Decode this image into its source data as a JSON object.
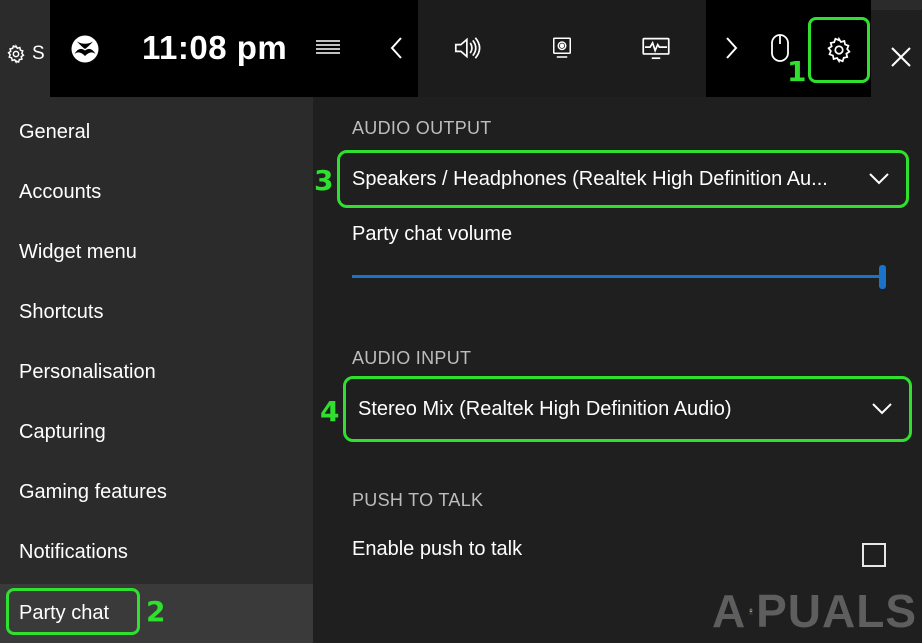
{
  "window": {
    "title_partial": "S"
  },
  "gamebar": {
    "clock": "11:08 pm"
  },
  "sidebar": {
    "items": [
      {
        "label": "General"
      },
      {
        "label": "Accounts"
      },
      {
        "label": "Widget menu"
      },
      {
        "label": "Shortcuts"
      },
      {
        "label": "Personalisation"
      },
      {
        "label": "Capturing"
      },
      {
        "label": "Gaming features"
      },
      {
        "label": "Notifications"
      },
      {
        "label": "Party chat"
      }
    ],
    "selected_index": 8
  },
  "main": {
    "audio_output": {
      "label": "AUDIO OUTPUT",
      "selected": "Speakers / Headphones (Realtek High Definition Au..."
    },
    "party_chat_volume": {
      "label": "Party chat volume",
      "value_fraction": 1.0
    },
    "audio_input": {
      "label": "AUDIO INPUT",
      "selected": "Stereo Mix (Realtek High Definition Audio)"
    },
    "push_to_talk": {
      "label": "PUSH TO TALK",
      "option_label": "Enable push to talk",
      "checked": false
    }
  },
  "markers": {
    "m1": "1",
    "m2": "2",
    "m3": "3",
    "m4": "4"
  },
  "watermark": {
    "text": "PUALS",
    "prefix": "A"
  },
  "icons": {
    "xbox": "xbox-logo-icon",
    "menu": "menu-icon",
    "prev": "chevron-left-icon",
    "next": "chevron-right-icon",
    "audio": "speaker-icon",
    "capture": "capture-icon",
    "performance": "performance-icon",
    "mouse": "mouse-icon",
    "settings": "gear-icon",
    "close": "close-icon"
  },
  "colors": {
    "highlight": "#2fe02f",
    "accent": "#1a73c9",
    "sidebar_bg": "#2b2b2b",
    "content_bg": "#1f1f1f",
    "bar_bg": "#000000"
  }
}
